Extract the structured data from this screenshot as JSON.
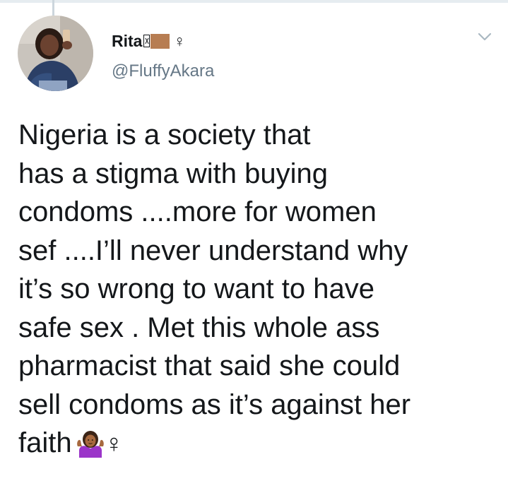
{
  "tweet": {
    "author": {
      "display_name": "Rita",
      "gender_symbol": "♀",
      "handle": "@FluffyAkara"
    },
    "text": "Nigeria is a society that\nhas a stigma with buying\ncondoms ....more for women\nsef ....I’ll never understand why\nit’s so wrong to want to have\nsafe sex . Met this whole ass\npharmacist that said she could\nsell condoms as it’s against her\nfaith",
    "trailing_emoji": "woman-shrugging-icon",
    "trailing_symbol": "♀"
  },
  "icons": {
    "menu": "chevron-down-icon"
  },
  "colors": {
    "text": "#14171a",
    "secondary_text": "#657786",
    "divider": "#e6ecf0",
    "skin_tone": "#b77d52"
  }
}
